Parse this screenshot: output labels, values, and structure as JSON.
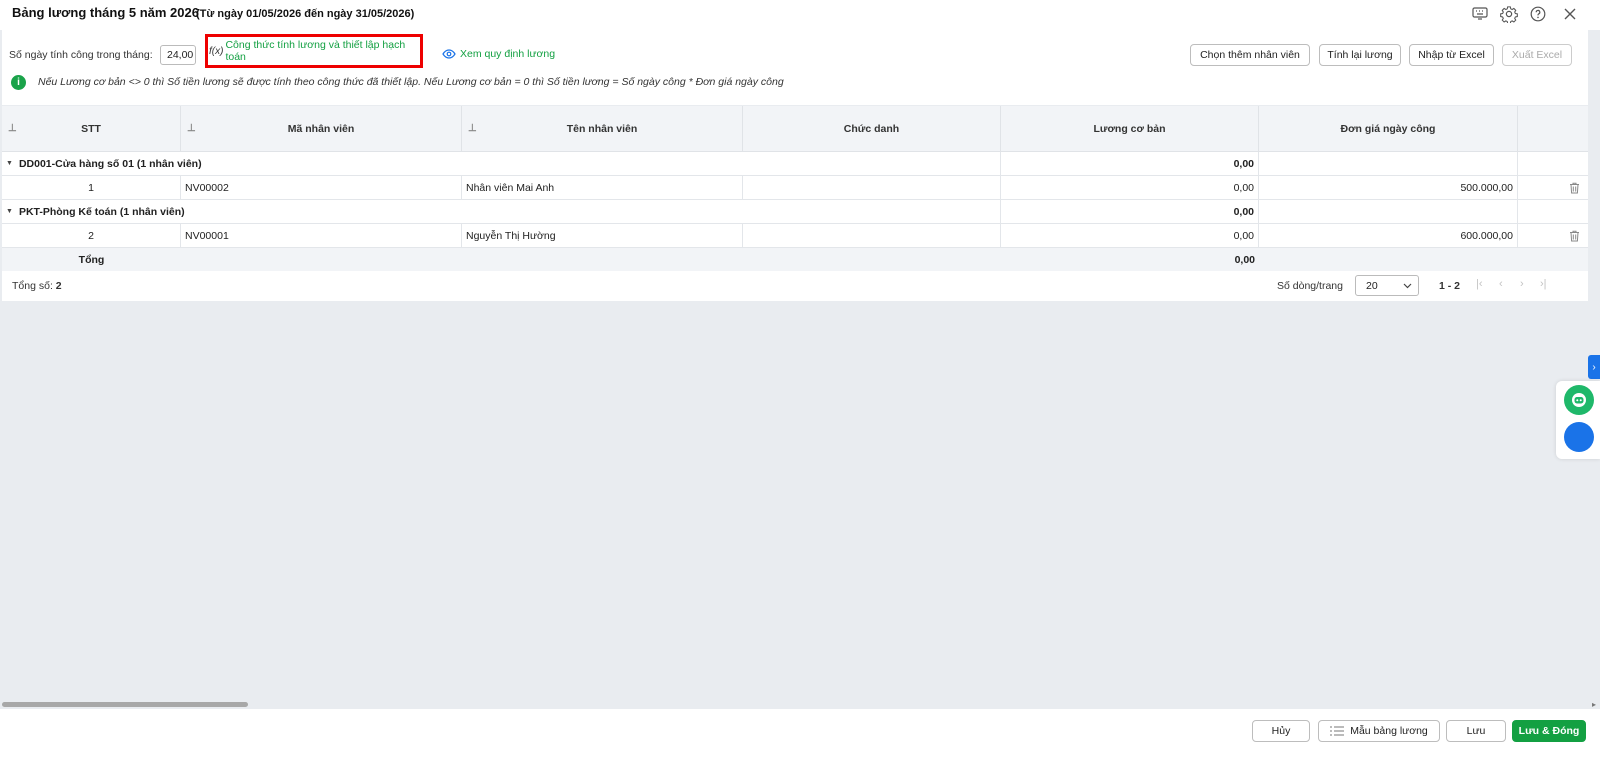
{
  "header": {
    "title": "Bảng lương tháng 5 năm 2026",
    "subtitle": "(Từ ngày 01/05/2026 đến ngày 31/05/2026)",
    "icons": [
      "keyboard-icon",
      "gear-icon",
      "help-icon",
      "close-icon"
    ]
  },
  "toolbar": {
    "days_label": "Số ngày tính công trong tháng:",
    "days_value": "24,00",
    "formula_prefix": "f(x)",
    "formula_link": "Công thức tính lương và thiết lập hạch toán",
    "view_rule_link": "Xem quy định lương",
    "buttons": {
      "add_employee": "Chọn thêm nhân viên",
      "recalc": "Tính lại lương",
      "import_excel": "Nhập từ Excel",
      "export_excel": "Xuất Excel"
    },
    "info_text": "Nếu Lương cơ bản <> 0 thì Số tiền lương sẽ được tính theo công thức đã thiết lập. Nếu Lương cơ bản = 0 thì Số tiền lương = Số ngày công * Đơn giá ngày công"
  },
  "table": {
    "columns": [
      "STT",
      "Mã nhân viên",
      "Tên nhân viên",
      "Chức danh",
      "Lương cơ bản",
      "Đơn giá ngày công"
    ],
    "groups": [
      {
        "label": "DD001-Cửa hàng số 01 (1 nhân viên)",
        "subtotal": "0,00",
        "rows": [
          {
            "stt": "1",
            "code": "NV00002",
            "name": "Nhân viên Mai Anh",
            "title": "",
            "base_salary": "0,00",
            "daily_rate": "500.000,00"
          }
        ]
      },
      {
        "label": "PKT-Phòng Kế toán (1 nhân viên)",
        "subtotal": "0,00",
        "rows": [
          {
            "stt": "2",
            "code": "NV00001",
            "name": "Nguyễn Thị Hường",
            "title": "",
            "base_salary": "0,00",
            "daily_rate": "600.000,00"
          }
        ]
      }
    ],
    "total_label": "Tổng",
    "total_value": "0,00"
  },
  "pagination": {
    "total_label": "Tổng số:",
    "total_count": "2",
    "rows_per_page_label": "Số dòng/trang",
    "rows_per_page": "20",
    "range": "1 - 2"
  },
  "bottom": {
    "cancel": "Hủy",
    "template": "Mẫu bảng lương",
    "save": "Lưu",
    "save_close": "Lưu & Đóng"
  }
}
